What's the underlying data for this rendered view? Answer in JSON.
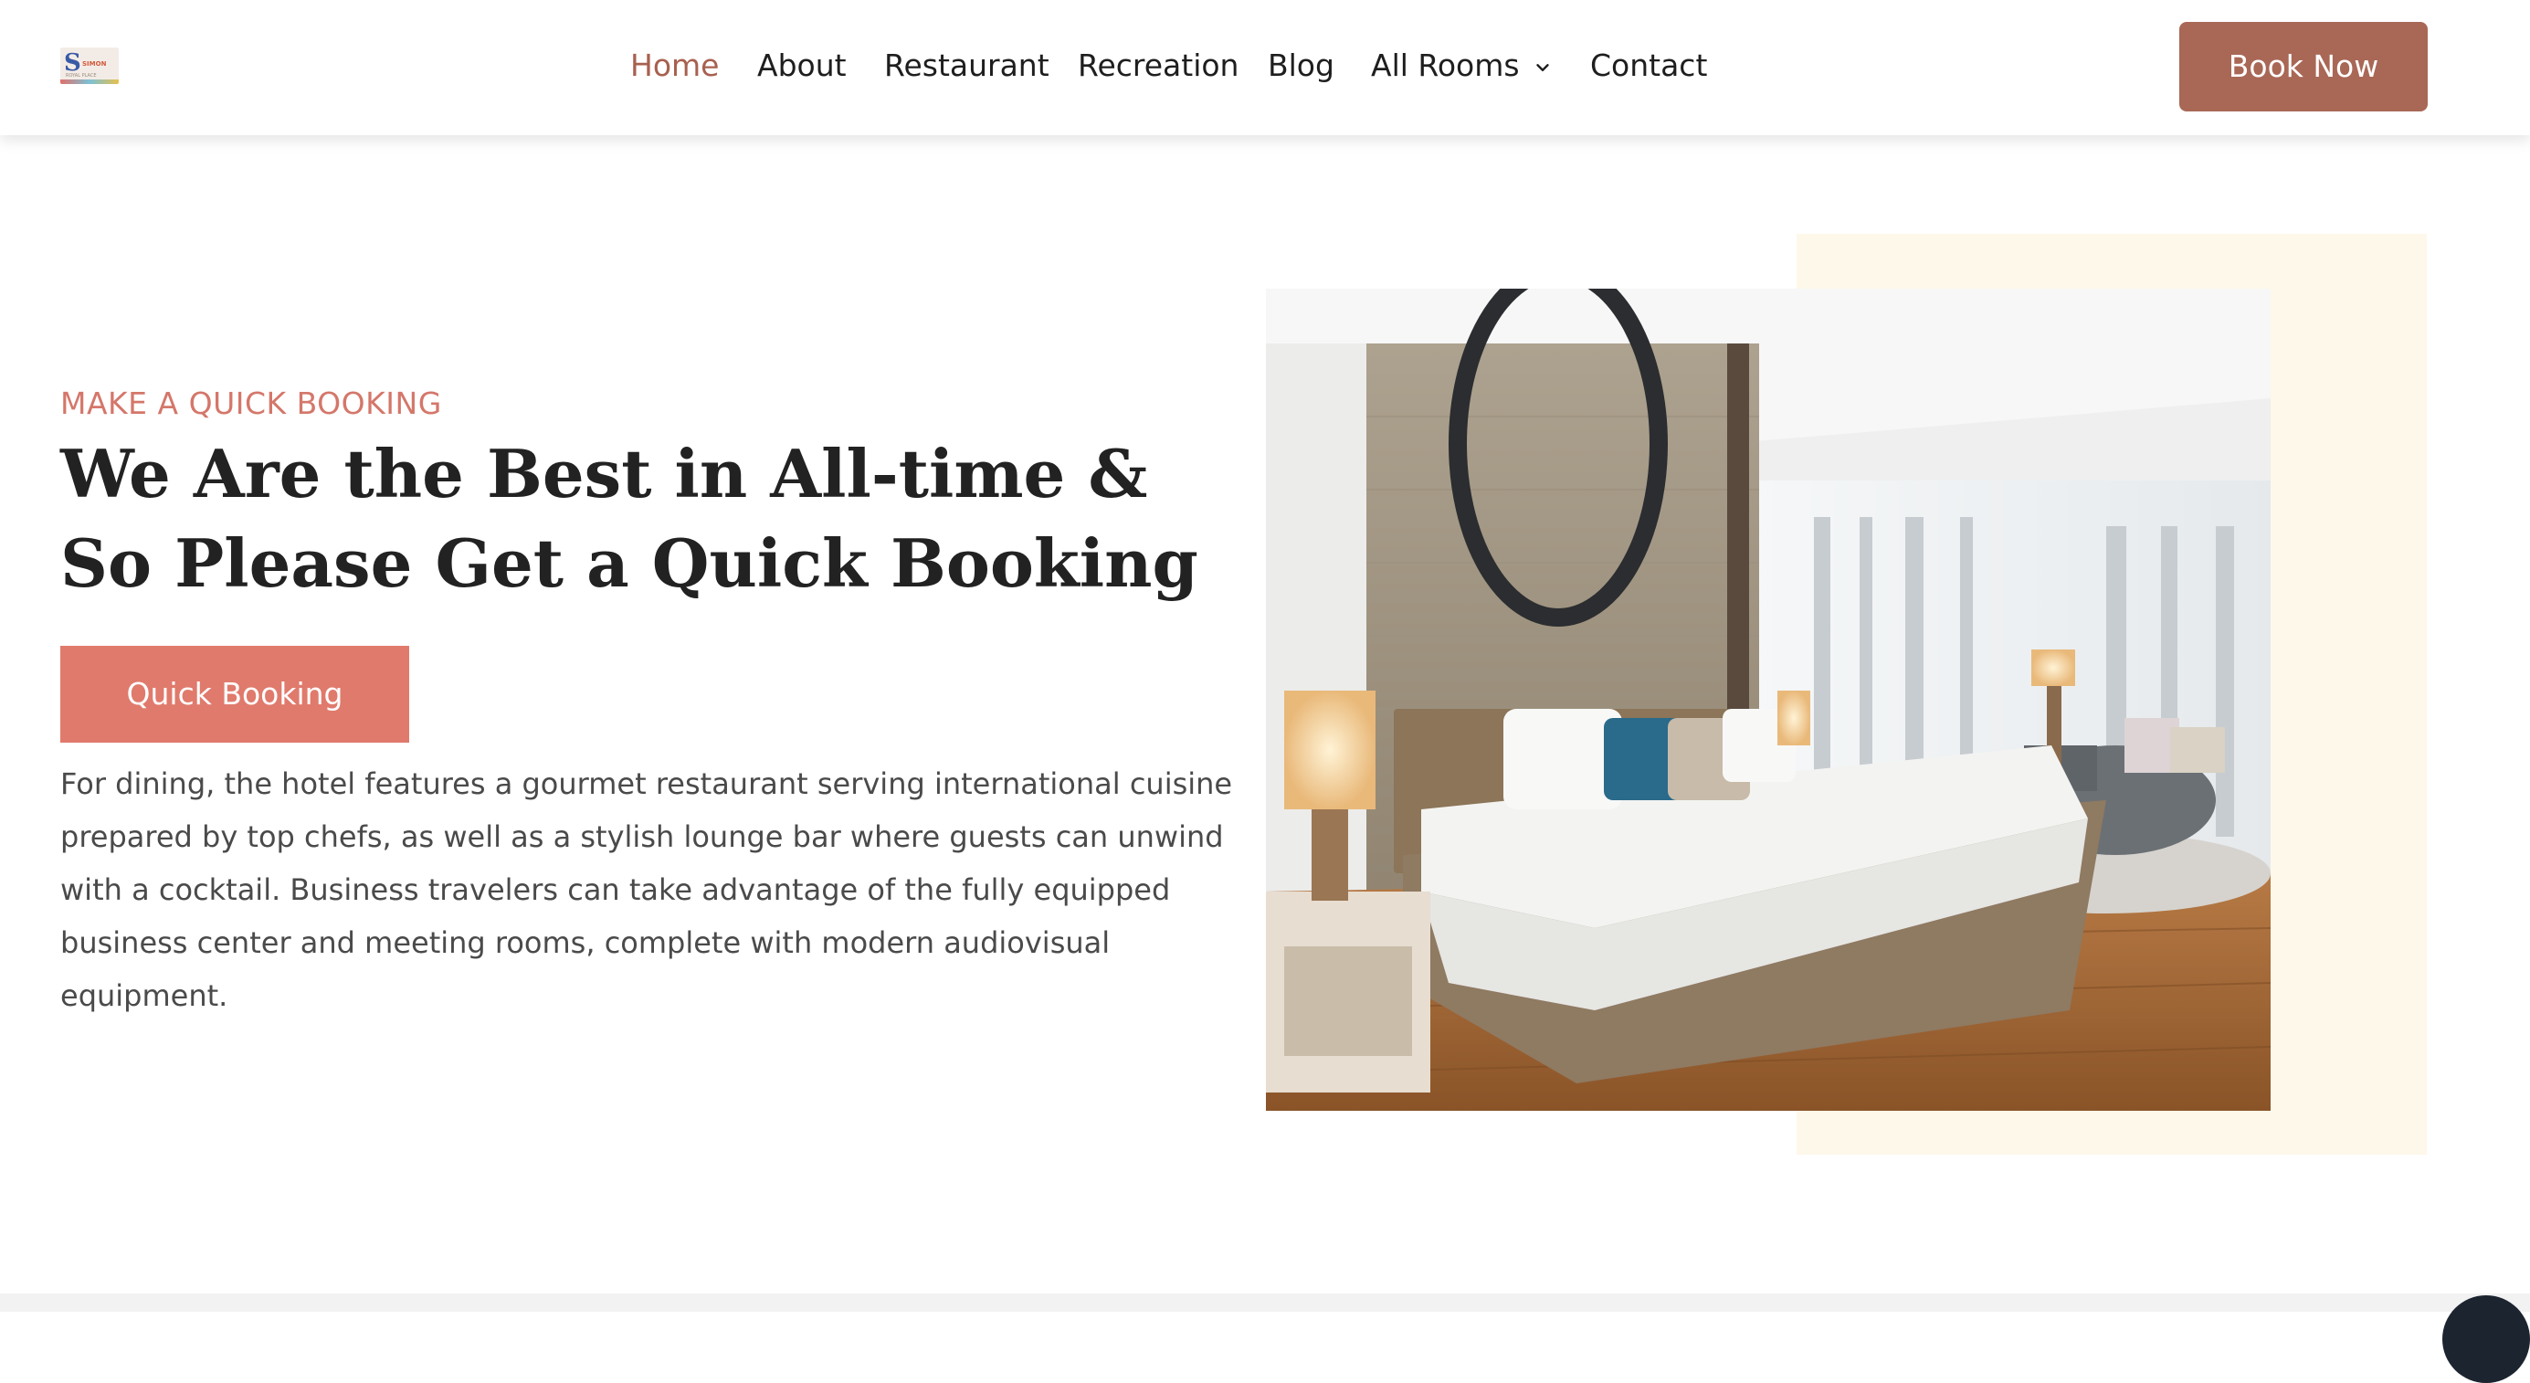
{
  "header": {
    "logo": {
      "letter": "S",
      "text": "SIMON",
      "sub": "ROYAL PLACE"
    },
    "nav": {
      "home": "Home",
      "about": "About",
      "restaurant": "Restaurant",
      "recreation": "Recreation",
      "blog": "Blog",
      "all_rooms": "All Rooms",
      "contact": "Contact"
    },
    "book_now": "Book Now"
  },
  "hero": {
    "eyebrow": "MAKE A QUICK BOOKING",
    "headline": "We Are the Best in All-time & So Please Get a Quick Booking",
    "button": "Quick Booking",
    "description": "For dining, the hotel features a gourmet restaurant serving international cuisine prepared by top chefs, as well as a stylish lounge bar where guests can unwind with a cocktail. Business travelers can take advantage of the fully equipped business center and meeting rooms, complete with modern audiovisual equipment."
  },
  "icons": {
    "dropdown": "chevron-down-icon",
    "chat": "chat-icon"
  },
  "colors": {
    "accent": "#a96756",
    "nav_active": "#a8604f",
    "eyebrow": "#d4776a",
    "quick_button": "#e07a6c",
    "cream": "#fdf8e9"
  }
}
